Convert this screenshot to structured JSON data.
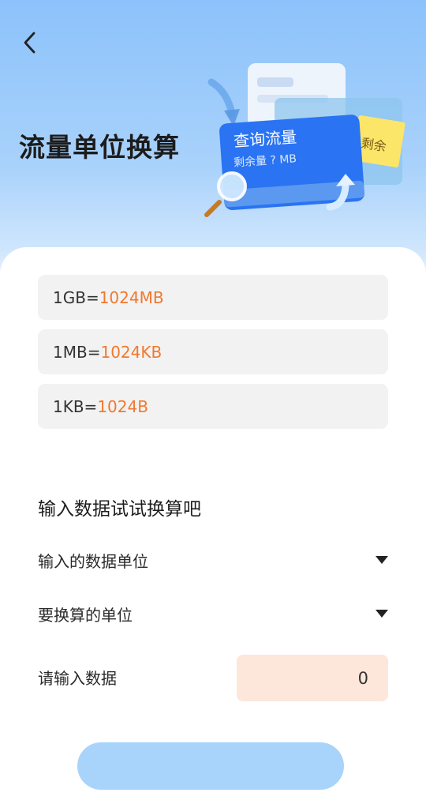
{
  "header": {
    "title": "流量单位换算",
    "back_icon": "back-arrow-icon"
  },
  "illustration": {
    "card_title": "查询流量",
    "card_subtitle": "剩余量 ? MB",
    "sticky_note": "剩余",
    "colors": {
      "card": "#2a73f2",
      "note": "#fbe66a"
    }
  },
  "rules": [
    {
      "left": "1GB=",
      "right": "1024MB"
    },
    {
      "left": "1MB=",
      "right": "1024KB"
    },
    {
      "left": "1KB=",
      "right": "1024B"
    }
  ],
  "converter": {
    "section_title": "输入数据试试换算吧",
    "from_unit_label": "输入的数据单位",
    "to_unit_label": "要换算的单位",
    "input_label": "请输入数据",
    "input_value": "0"
  },
  "colors": {
    "accent": "#f2782d",
    "input_bg": "#fde6da",
    "rule_bg": "#f2f2f2",
    "button": "#a8d4fb"
  }
}
